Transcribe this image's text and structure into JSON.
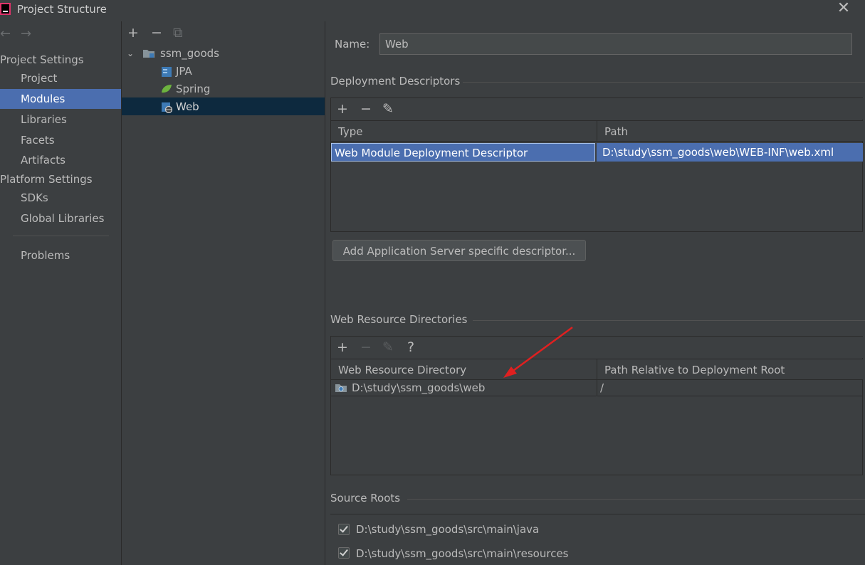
{
  "window": {
    "title": "Project Structure",
    "close_glyph": "✕"
  },
  "nav": {
    "back_glyph": "←",
    "forward_glyph": "→",
    "project_settings_label": "Project Settings",
    "project_settings_items": [
      "Project",
      "Modules",
      "Libraries",
      "Facets",
      "Artifacts"
    ],
    "platform_settings_label": "Platform Settings",
    "platform_settings_items": [
      "SDKs",
      "Global Libraries"
    ],
    "problems_label": "Problems",
    "selected": "Modules"
  },
  "tree": {
    "toolbar": {
      "add": "+",
      "remove": "−",
      "copy": "⧉"
    },
    "root": "ssm_goods",
    "children": [
      "JPA",
      "Spring",
      "Web"
    ],
    "selected": "Web"
  },
  "facet": {
    "name_label": "Name:",
    "name_value": "Web",
    "deployment": {
      "title": "Deployment Descriptors",
      "toolbar": {
        "add": "+",
        "remove": "−",
        "edit": "✎"
      },
      "columns": [
        "Type",
        "Path"
      ],
      "rows": [
        {
          "type": "Web Module Deployment Descriptor",
          "path": "D:\\study\\ssm_goods\\web\\WEB-INF\\web.xml"
        }
      ],
      "add_server_button": "Add Application Server specific descriptor..."
    },
    "web_resources": {
      "title": "Web Resource Directories",
      "toolbar": {
        "add": "+",
        "remove": "−",
        "edit": "✎",
        "help": "?"
      },
      "columns": [
        "Web Resource Directory",
        "Path Relative to Deployment Root"
      ],
      "rows": [
        {
          "directory": "D:\\study\\ssm_goods\\web",
          "relative": "/"
        }
      ]
    },
    "source_roots": {
      "title": "Source Roots",
      "items": [
        {
          "path": "D:\\study\\ssm_goods\\src\\main\\java",
          "checked": true
        },
        {
          "path": "D:\\study\\ssm_goods\\src\\main\\resources",
          "checked": true
        }
      ]
    }
  },
  "colors": {
    "background": "#3c3f41",
    "selection": "#4b6eaf",
    "tree_selection": "#0d293e",
    "annotation_arrow": "#e02020"
  }
}
